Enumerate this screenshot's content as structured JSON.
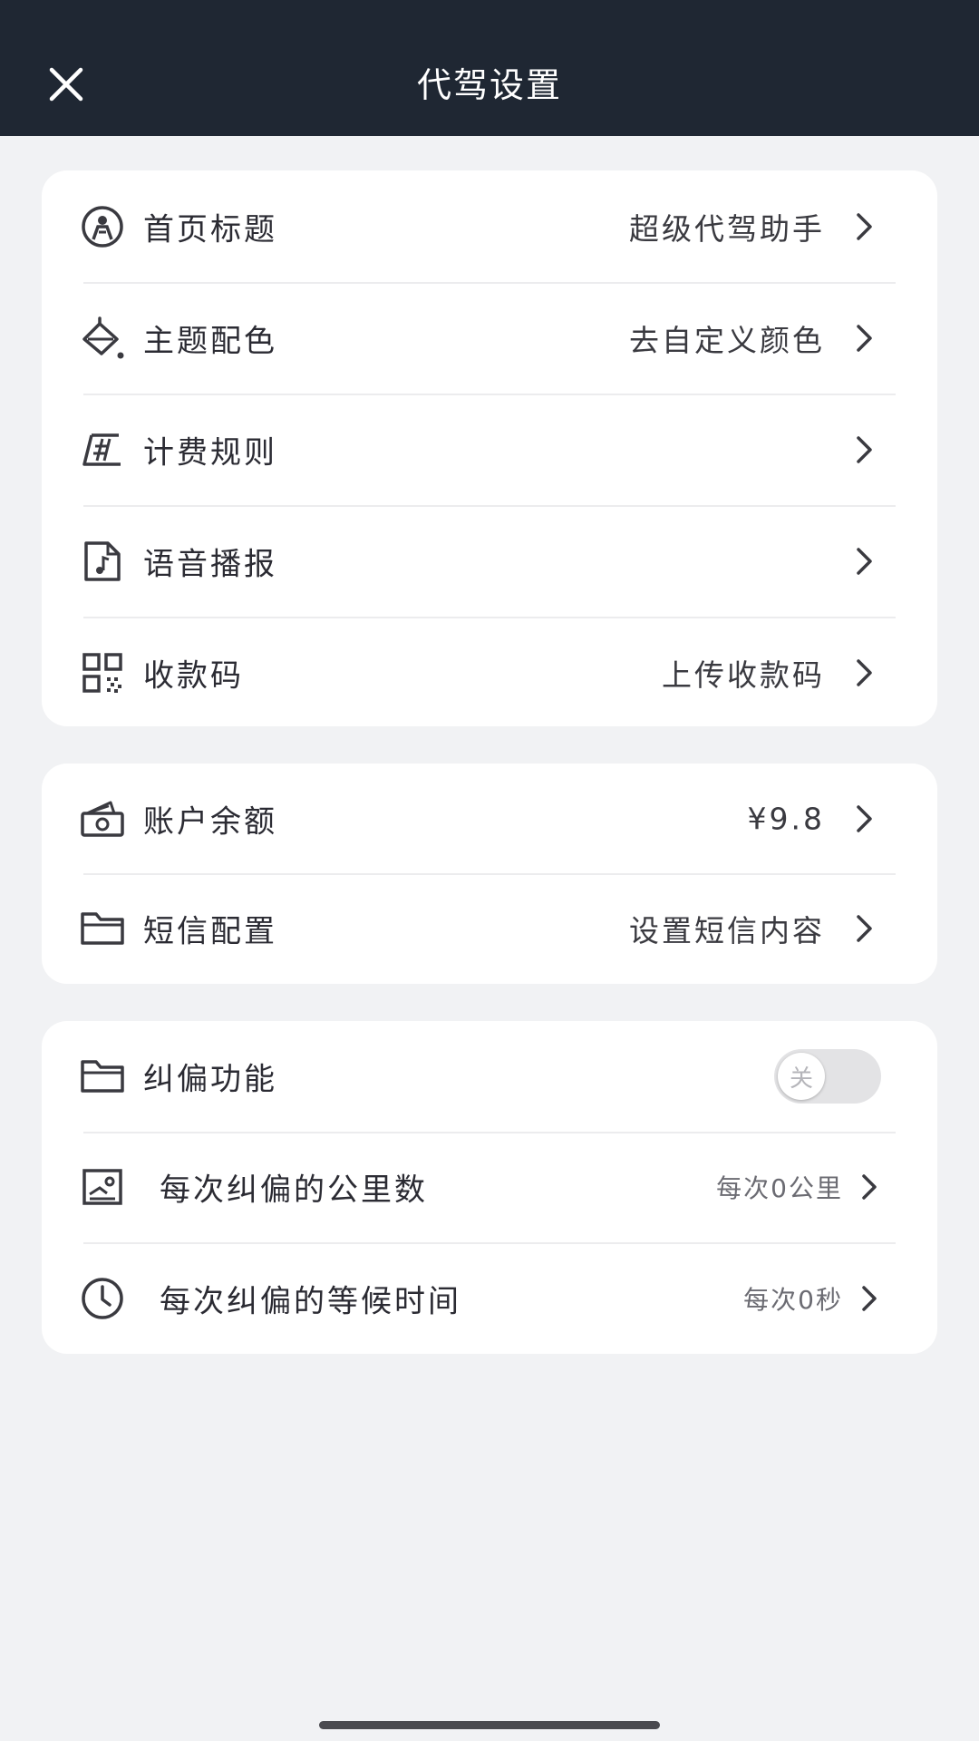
{
  "header": {
    "title": "代驾设置",
    "close_icon": "close-icon"
  },
  "section1": [
    {
      "icon": "user-circle-icon",
      "label": "首页标题",
      "value": "超级代驾助手"
    },
    {
      "icon": "paint-bucket-icon",
      "label": "主题配色",
      "value": "去自定义颜色"
    },
    {
      "icon": "ruler-icon",
      "label": "计费规则",
      "value": ""
    },
    {
      "icon": "music-file-icon",
      "label": "语音播报",
      "value": ""
    },
    {
      "icon": "qr-code-icon",
      "label": "收款码",
      "value": "上传收款码"
    }
  ],
  "section2": [
    {
      "icon": "cash-icon",
      "label": "账户余额",
      "value": "¥9.8"
    },
    {
      "icon": "folder-icon",
      "label": "短信配置",
      "value": "设置短信内容"
    }
  ],
  "section3": {
    "toggle_row": {
      "icon": "folder-icon",
      "label": "纠偏功能",
      "toggle_text": "关",
      "enabled": false
    },
    "rows": [
      {
        "icon": "image-card-icon",
        "label": "每次纠偏的公里数",
        "value": "每次0公里"
      },
      {
        "icon": "clock-icon",
        "label": "每次纠偏的等候时间",
        "value": "每次0秒"
      }
    ]
  },
  "colors": {
    "header_bg": "#1f2733",
    "page_bg": "#f1f2f4",
    "card_bg": "#ffffff",
    "text": "#2b2b33"
  }
}
